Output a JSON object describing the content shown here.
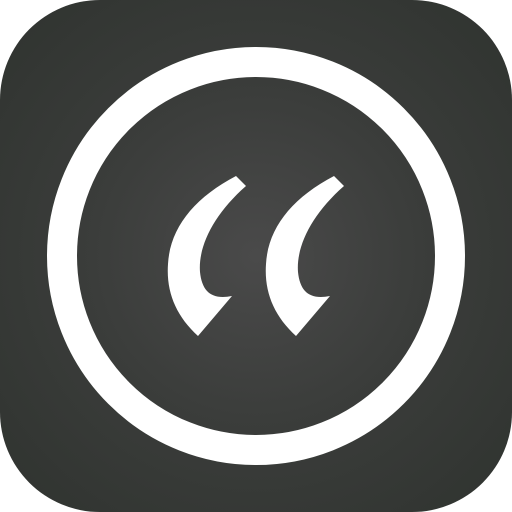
{
  "icon": {
    "semantic": "quote-icon",
    "colors": {
      "tile_dark": "#2f332f",
      "tile_mid": "#3b3d3b",
      "tile_center": "#4a4a4a",
      "ring": "#ffffff",
      "glyph": "#ffffff"
    }
  }
}
